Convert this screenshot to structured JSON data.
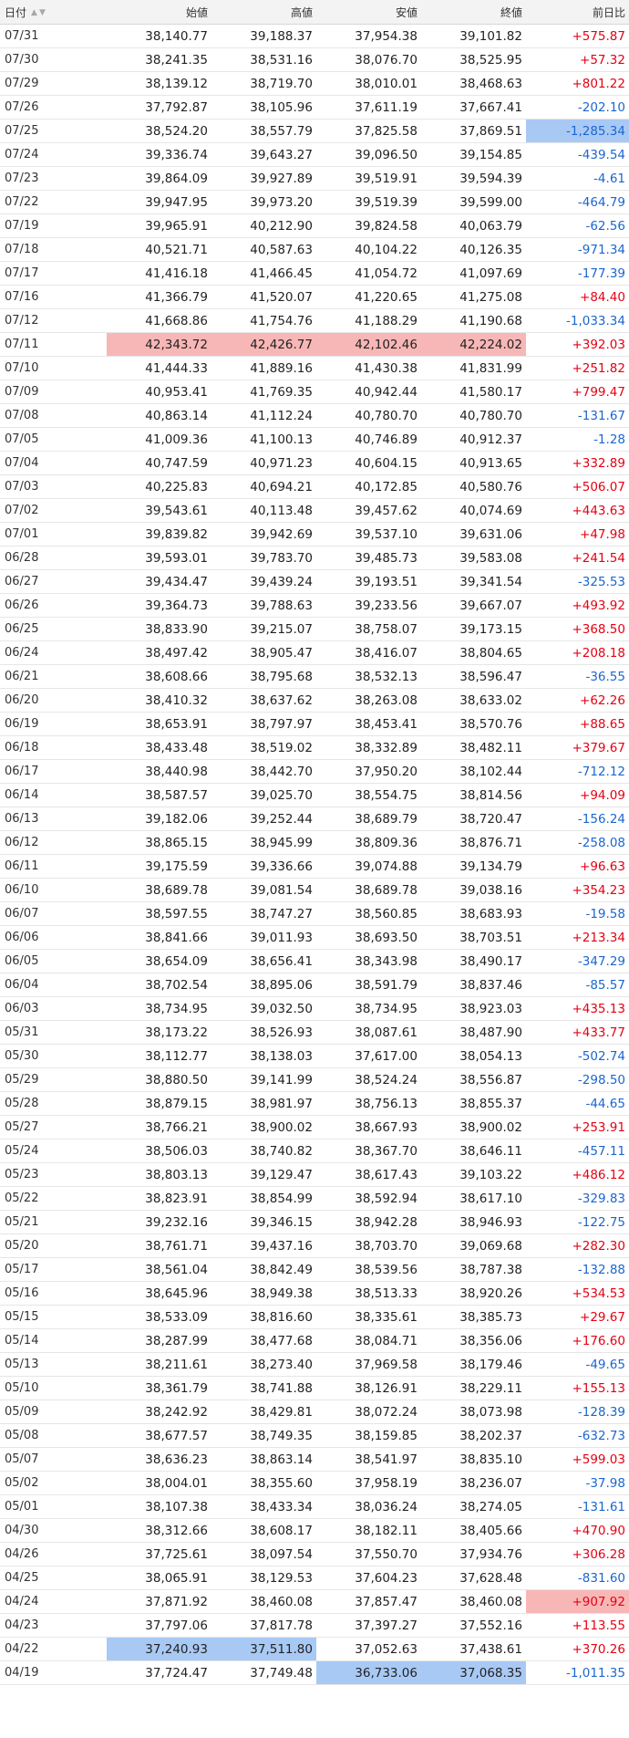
{
  "header": {
    "date": "日付",
    "sort_up": "▲",
    "sort_down": "▼",
    "open": "始値",
    "high": "高値",
    "low": "安値",
    "close": "終値",
    "change": "前日比"
  },
  "colors": {
    "up": "#e60012",
    "down": "#1a66d0",
    "highlight_high": "#f8b7b7",
    "highlight_low": "#a9c9f5"
  },
  "rows": [
    {
      "date": "07/31",
      "open": "38,140.77",
      "high": "39,188.37",
      "low": "37,954.38",
      "close": "39,101.82",
      "change": "+575.87"
    },
    {
      "date": "07/30",
      "open": "38,241.35",
      "high": "38,531.16",
      "low": "38,076.70",
      "close": "38,525.95",
      "change": "+57.32"
    },
    {
      "date": "07/29",
      "open": "38,139.12",
      "high": "38,719.70",
      "low": "38,010.01",
      "close": "38,468.63",
      "change": "+801.22"
    },
    {
      "date": "07/26",
      "open": "37,792.87",
      "high": "38,105.96",
      "low": "37,611.19",
      "close": "37,667.41",
      "change": "-202.10"
    },
    {
      "date": "07/25",
      "open": "38,524.20",
      "high": "38,557.79",
      "low": "37,825.58",
      "close": "37,869.51",
      "change": "-1,285.34",
      "hl": {
        "change": "lo"
      }
    },
    {
      "date": "07/24",
      "open": "39,336.74",
      "high": "39,643.27",
      "low": "39,096.50",
      "close": "39,154.85",
      "change": "-439.54"
    },
    {
      "date": "07/23",
      "open": "39,864.09",
      "high": "39,927.89",
      "low": "39,519.91",
      "close": "39,594.39",
      "change": "-4.61"
    },
    {
      "date": "07/22",
      "open": "39,947.95",
      "high": "39,973.20",
      "low": "39,519.39",
      "close": "39,599.00",
      "change": "-464.79"
    },
    {
      "date": "07/19",
      "open": "39,965.91",
      "high": "40,212.90",
      "low": "39,824.58",
      "close": "40,063.79",
      "change": "-62.56"
    },
    {
      "date": "07/18",
      "open": "40,521.71",
      "high": "40,587.63",
      "low": "40,104.22",
      "close": "40,126.35",
      "change": "-971.34"
    },
    {
      "date": "07/17",
      "open": "41,416.18",
      "high": "41,466.45",
      "low": "41,054.72",
      "close": "41,097.69",
      "change": "-177.39"
    },
    {
      "date": "07/16",
      "open": "41,366.79",
      "high": "41,520.07",
      "low": "41,220.65",
      "close": "41,275.08",
      "change": "+84.40"
    },
    {
      "date": "07/12",
      "open": "41,668.86",
      "high": "41,754.76",
      "low": "41,188.29",
      "close": "41,190.68",
      "change": "-1,033.34"
    },
    {
      "date": "07/11",
      "open": "42,343.72",
      "high": "42,426.77",
      "low": "42,102.46",
      "close": "42,224.02",
      "change": "+392.03",
      "hl": {
        "open": "hi",
        "high": "hi",
        "low": "hi",
        "close": "hi"
      }
    },
    {
      "date": "07/10",
      "open": "41,444.33",
      "high": "41,889.16",
      "low": "41,430.38",
      "close": "41,831.99",
      "change": "+251.82"
    },
    {
      "date": "07/09",
      "open": "40,953.41",
      "high": "41,769.35",
      "low": "40,942.44",
      "close": "41,580.17",
      "change": "+799.47"
    },
    {
      "date": "07/08",
      "open": "40,863.14",
      "high": "41,112.24",
      "low": "40,780.70",
      "close": "40,780.70",
      "change": "-131.67"
    },
    {
      "date": "07/05",
      "open": "41,009.36",
      "high": "41,100.13",
      "low": "40,746.89",
      "close": "40,912.37",
      "change": "-1.28"
    },
    {
      "date": "07/04",
      "open": "40,747.59",
      "high": "40,971.23",
      "low": "40,604.15",
      "close": "40,913.65",
      "change": "+332.89"
    },
    {
      "date": "07/03",
      "open": "40,225.83",
      "high": "40,694.21",
      "low": "40,172.85",
      "close": "40,580.76",
      "change": "+506.07"
    },
    {
      "date": "07/02",
      "open": "39,543.61",
      "high": "40,113.48",
      "low": "39,457.62",
      "close": "40,074.69",
      "change": "+443.63"
    },
    {
      "date": "07/01",
      "open": "39,839.82",
      "high": "39,942.69",
      "low": "39,537.10",
      "close": "39,631.06",
      "change": "+47.98"
    },
    {
      "date": "06/28",
      "open": "39,593.01",
      "high": "39,783.70",
      "low": "39,485.73",
      "close": "39,583.08",
      "change": "+241.54"
    },
    {
      "date": "06/27",
      "open": "39,434.47",
      "high": "39,439.24",
      "low": "39,193.51",
      "close": "39,341.54",
      "change": "-325.53"
    },
    {
      "date": "06/26",
      "open": "39,364.73",
      "high": "39,788.63",
      "low": "39,233.56",
      "close": "39,667.07",
      "change": "+493.92"
    },
    {
      "date": "06/25",
      "open": "38,833.90",
      "high": "39,215.07",
      "low": "38,758.07",
      "close": "39,173.15",
      "change": "+368.50"
    },
    {
      "date": "06/24",
      "open": "38,497.42",
      "high": "38,905.47",
      "low": "38,416.07",
      "close": "38,804.65",
      "change": "+208.18"
    },
    {
      "date": "06/21",
      "open": "38,608.66",
      "high": "38,795.68",
      "low": "38,532.13",
      "close": "38,596.47",
      "change": "-36.55"
    },
    {
      "date": "06/20",
      "open": "38,410.32",
      "high": "38,637.62",
      "low": "38,263.08",
      "close": "38,633.02",
      "change": "+62.26"
    },
    {
      "date": "06/19",
      "open": "38,653.91",
      "high": "38,797.97",
      "low": "38,453.41",
      "close": "38,570.76",
      "change": "+88.65"
    },
    {
      "date": "06/18",
      "open": "38,433.48",
      "high": "38,519.02",
      "low": "38,332.89",
      "close": "38,482.11",
      "change": "+379.67"
    },
    {
      "date": "06/17",
      "open": "38,440.98",
      "high": "38,442.70",
      "low": "37,950.20",
      "close": "38,102.44",
      "change": "-712.12"
    },
    {
      "date": "06/14",
      "open": "38,587.57",
      "high": "39,025.70",
      "low": "38,554.75",
      "close": "38,814.56",
      "change": "+94.09"
    },
    {
      "date": "06/13",
      "open": "39,182.06",
      "high": "39,252.44",
      "low": "38,689.79",
      "close": "38,720.47",
      "change": "-156.24"
    },
    {
      "date": "06/12",
      "open": "38,865.15",
      "high": "38,945.99",
      "low": "38,809.36",
      "close": "38,876.71",
      "change": "-258.08"
    },
    {
      "date": "06/11",
      "open": "39,175.59",
      "high": "39,336.66",
      "low": "39,074.88",
      "close": "39,134.79",
      "change": "+96.63"
    },
    {
      "date": "06/10",
      "open": "38,689.78",
      "high": "39,081.54",
      "low": "38,689.78",
      "close": "39,038.16",
      "change": "+354.23"
    },
    {
      "date": "06/07",
      "open": "38,597.55",
      "high": "38,747.27",
      "low": "38,560.85",
      "close": "38,683.93",
      "change": "-19.58"
    },
    {
      "date": "06/06",
      "open": "38,841.66",
      "high": "39,011.93",
      "low": "38,693.50",
      "close": "38,703.51",
      "change": "+213.34"
    },
    {
      "date": "06/05",
      "open": "38,654.09",
      "high": "38,656.41",
      "low": "38,343.98",
      "close": "38,490.17",
      "change": "-347.29"
    },
    {
      "date": "06/04",
      "open": "38,702.54",
      "high": "38,895.06",
      "low": "38,591.79",
      "close": "38,837.46",
      "change": "-85.57"
    },
    {
      "date": "06/03",
      "open": "38,734.95",
      "high": "39,032.50",
      "low": "38,734.95",
      "close": "38,923.03",
      "change": "+435.13"
    },
    {
      "date": "05/31",
      "open": "38,173.22",
      "high": "38,526.93",
      "low": "38,087.61",
      "close": "38,487.90",
      "change": "+433.77"
    },
    {
      "date": "05/30",
      "open": "38,112.77",
      "high": "38,138.03",
      "low": "37,617.00",
      "close": "38,054.13",
      "change": "-502.74"
    },
    {
      "date": "05/29",
      "open": "38,880.50",
      "high": "39,141.99",
      "low": "38,524.24",
      "close": "38,556.87",
      "change": "-298.50"
    },
    {
      "date": "05/28",
      "open": "38,879.15",
      "high": "38,981.97",
      "low": "38,756.13",
      "close": "38,855.37",
      "change": "-44.65"
    },
    {
      "date": "05/27",
      "open": "38,766.21",
      "high": "38,900.02",
      "low": "38,667.93",
      "close": "38,900.02",
      "change": "+253.91"
    },
    {
      "date": "05/24",
      "open": "38,506.03",
      "high": "38,740.82",
      "low": "38,367.70",
      "close": "38,646.11",
      "change": "-457.11"
    },
    {
      "date": "05/23",
      "open": "38,803.13",
      "high": "39,129.47",
      "low": "38,617.43",
      "close": "39,103.22",
      "change": "+486.12"
    },
    {
      "date": "05/22",
      "open": "38,823.91",
      "high": "38,854.99",
      "low": "38,592.94",
      "close": "38,617.10",
      "change": "-329.83"
    },
    {
      "date": "05/21",
      "open": "39,232.16",
      "high": "39,346.15",
      "low": "38,942.28",
      "close": "38,946.93",
      "change": "-122.75"
    },
    {
      "date": "05/20",
      "open": "38,761.71",
      "high": "39,437.16",
      "low": "38,703.70",
      "close": "39,069.68",
      "change": "+282.30"
    },
    {
      "date": "05/17",
      "open": "38,561.04",
      "high": "38,842.49",
      "low": "38,539.56",
      "close": "38,787.38",
      "change": "-132.88"
    },
    {
      "date": "05/16",
      "open": "38,645.96",
      "high": "38,949.38",
      "low": "38,513.33",
      "close": "38,920.26",
      "change": "+534.53"
    },
    {
      "date": "05/15",
      "open": "38,533.09",
      "high": "38,816.60",
      "low": "38,335.61",
      "close": "38,385.73",
      "change": "+29.67"
    },
    {
      "date": "05/14",
      "open": "38,287.99",
      "high": "38,477.68",
      "low": "38,084.71",
      "close": "38,356.06",
      "change": "+176.60"
    },
    {
      "date": "05/13",
      "open": "38,211.61",
      "high": "38,273.40",
      "low": "37,969.58",
      "close": "38,179.46",
      "change": "-49.65"
    },
    {
      "date": "05/10",
      "open": "38,361.79",
      "high": "38,741.88",
      "low": "38,126.91",
      "close": "38,229.11",
      "change": "+155.13"
    },
    {
      "date": "05/09",
      "open": "38,242.92",
      "high": "38,429.81",
      "low": "38,072.24",
      "close": "38,073.98",
      "change": "-128.39"
    },
    {
      "date": "05/08",
      "open": "38,677.57",
      "high": "38,749.35",
      "low": "38,159.85",
      "close": "38,202.37",
      "change": "-632.73"
    },
    {
      "date": "05/07",
      "open": "38,636.23",
      "high": "38,863.14",
      "low": "38,541.97",
      "close": "38,835.10",
      "change": "+599.03"
    },
    {
      "date": "05/02",
      "open": "38,004.01",
      "high": "38,355.60",
      "low": "37,958.19",
      "close": "38,236.07",
      "change": "-37.98"
    },
    {
      "date": "05/01",
      "open": "38,107.38",
      "high": "38,433.34",
      "low": "38,036.24",
      "close": "38,274.05",
      "change": "-131.61"
    },
    {
      "date": "04/30",
      "open": "38,312.66",
      "high": "38,608.17",
      "low": "38,182.11",
      "close": "38,405.66",
      "change": "+470.90"
    },
    {
      "date": "04/26",
      "open": "37,725.61",
      "high": "38,097.54",
      "low": "37,550.70",
      "close": "37,934.76",
      "change": "+306.28"
    },
    {
      "date": "04/25",
      "open": "38,065.91",
      "high": "38,129.53",
      "low": "37,604.23",
      "close": "37,628.48",
      "change": "-831.60"
    },
    {
      "date": "04/24",
      "open": "37,871.92",
      "high": "38,460.08",
      "low": "37,857.47",
      "close": "38,460.08",
      "change": "+907.92",
      "hl": {
        "change": "hi"
      }
    },
    {
      "date": "04/23",
      "open": "37,797.06",
      "high": "37,817.78",
      "low": "37,397.27",
      "close": "37,552.16",
      "change": "+113.55"
    },
    {
      "date": "04/22",
      "open": "37,240.93",
      "high": "37,511.80",
      "low": "37,052.63",
      "close": "37,438.61",
      "change": "+370.26",
      "hl": {
        "open": "lo",
        "high": "lo"
      }
    },
    {
      "date": "04/19",
      "open": "37,724.47",
      "high": "37,749.48",
      "low": "36,733.06",
      "close": "37,068.35",
      "change": "-1,011.35",
      "hl": {
        "low": "lo",
        "close": "lo"
      }
    }
  ]
}
